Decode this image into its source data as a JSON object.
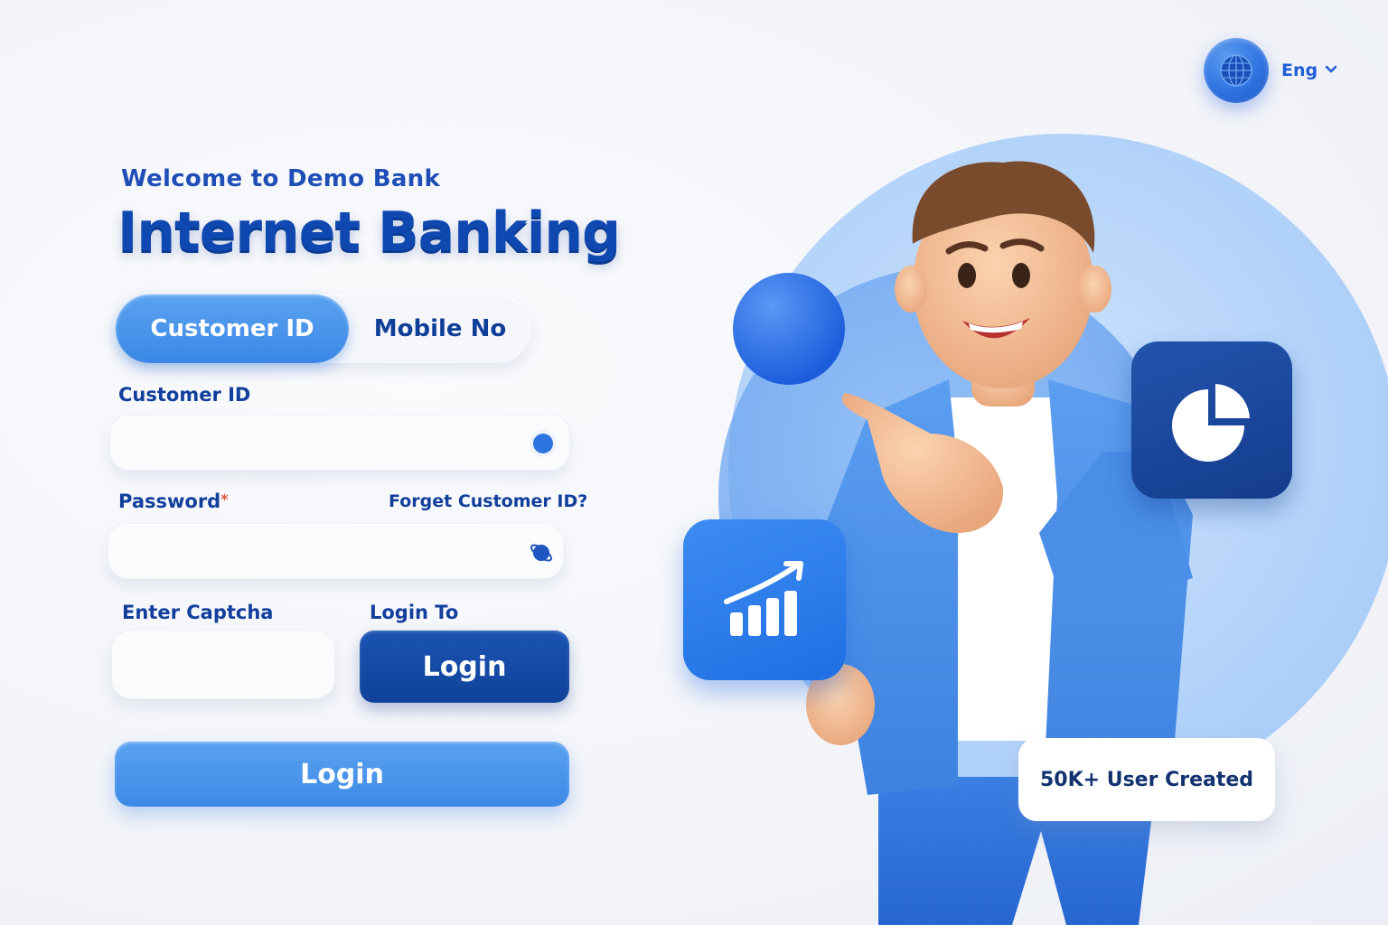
{
  "language": {
    "label": "Eng",
    "icon": "globe-icon"
  },
  "header": {
    "welcome": "Welcome to Demo Bank",
    "title": "Internet Banking"
  },
  "tabs": [
    {
      "label": "Customer ID",
      "active": true
    },
    {
      "label": "Mobile No",
      "active": false
    }
  ],
  "form": {
    "customer_id_label": "Customer ID",
    "customer_id_value": "",
    "password_label": "Password",
    "password_required_mark": "*",
    "password_value": "",
    "forgot_link": "Forget Customer ID?",
    "captcha_label": "Enter Captcha",
    "captcha_value": "",
    "login_to_label": "Login To",
    "login_to_button": "Login",
    "submit_label": "Login"
  },
  "illustration": {
    "stat_badge": "50K+ User Created",
    "chart_tile_icon": "growth-chart-icon",
    "pie_tile_icon": "pie-chart-icon"
  },
  "colors": {
    "primary": "#3d89e6",
    "primary_dark": "#0f4298",
    "heading": "#0f48b0",
    "background": "#f3f5fa"
  }
}
